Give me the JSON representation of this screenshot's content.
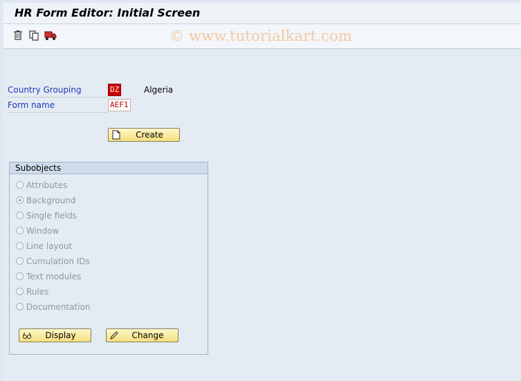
{
  "window": {
    "title": "HR Form Editor: Initial Screen"
  },
  "toolbar": {
    "icons": [
      "trash-icon",
      "copy-icon",
      "transport-icon"
    ],
    "watermark": "© www.tutorialkart.com"
  },
  "form": {
    "country_grouping_label": "Country Grouping",
    "country_grouping_value": "DZ",
    "country_name": "Algeria",
    "form_name_label": "Form name",
    "form_name_value": "AEF1",
    "create_label": "Create"
  },
  "subobjects": {
    "title": "Subobjects",
    "options": [
      {
        "label": "Attributes",
        "checked": false
      },
      {
        "label": "Background",
        "checked": true
      },
      {
        "label": "Single fields",
        "checked": false
      },
      {
        "label": "Window",
        "checked": false
      },
      {
        "label": "Line layout",
        "checked": false
      },
      {
        "label": "Cumulation IDs",
        "checked": false
      },
      {
        "label": "Text modules",
        "checked": false
      },
      {
        "label": "Rules",
        "checked": false
      },
      {
        "label": "Documentation",
        "checked": false
      }
    ],
    "display_label": "Display",
    "change_label": "Change"
  }
}
